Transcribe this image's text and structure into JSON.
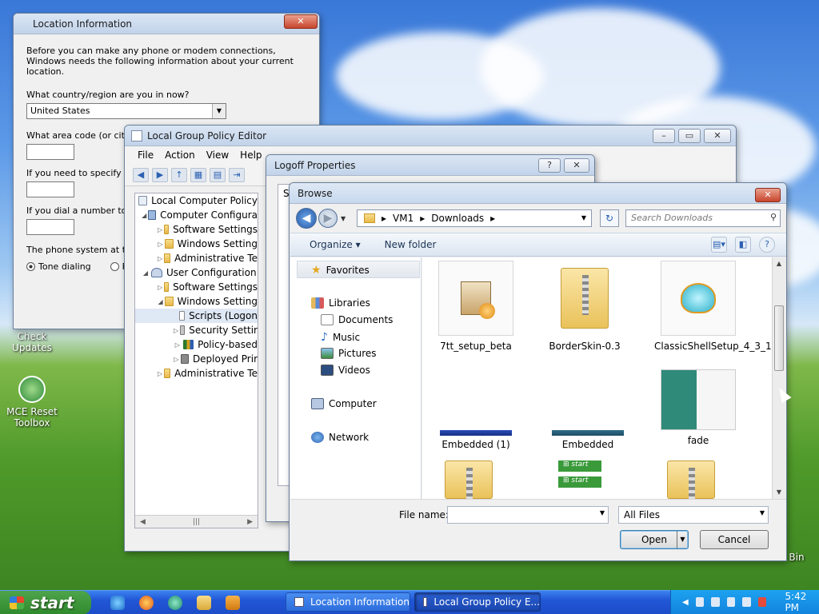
{
  "desktop": {
    "icons": [
      {
        "label": "Check Updates"
      },
      {
        "label": "MCE Reset Toolbox"
      },
      {
        "label": "Bin"
      }
    ]
  },
  "location_window": {
    "title": "Location Information",
    "intro": "Before you can make any phone or modem connections, Windows needs the following information about your current location.",
    "q_country": "What country/region are you in now?",
    "country_value": "United States",
    "q_area": "What area code (or city c",
    "q_carrier": "If you need to specify a c",
    "q_dial": "If you dial a number to ac",
    "q_phone_system": "The phone system at this",
    "tone_label": "Tone dialing",
    "pulse_label": "Pu"
  },
  "gpe": {
    "title": "Local Group Policy Editor",
    "menu": [
      "File",
      "Action",
      "View",
      "Help"
    ],
    "tree": [
      {
        "label": "Local Computer Policy"
      },
      {
        "label": "Computer Configura"
      },
      {
        "label": "Software Settings"
      },
      {
        "label": "Windows Setting"
      },
      {
        "label": "Administrative Te"
      },
      {
        "label": "User Configuration"
      },
      {
        "label": "Software Settings"
      },
      {
        "label": "Windows Setting"
      },
      {
        "label": "Scripts (Logon"
      },
      {
        "label": "Security Settir"
      },
      {
        "label": "Policy-based"
      },
      {
        "label": "Deployed Prir"
      },
      {
        "label": "Administrative Te"
      }
    ]
  },
  "logoff": {
    "title": "Logoff Properties",
    "help": "?",
    "body_char": "S"
  },
  "browse": {
    "title": "Browse",
    "breadcrumb": [
      "VM1",
      "Downloads"
    ],
    "search_placeholder": "Search Downloads",
    "organize": "Organize",
    "new_folder": "New folder",
    "nav": {
      "favorites": "Favorites",
      "libraries": "Libraries",
      "documents": "Documents",
      "music": "Music",
      "pictures": "Pictures",
      "videos": "Videos",
      "computer": "Computer",
      "network": "Network"
    },
    "files": [
      {
        "name": "7tt_setup_beta"
      },
      {
        "name": "BorderSkin-0.3"
      },
      {
        "name": "ClassicShellSetup_4_3_1"
      },
      {
        "name": "Embedded (1)"
      },
      {
        "name": "Embedded"
      },
      {
        "name": "fade"
      }
    ],
    "file_name_label": "File name:",
    "file_type": "All Files",
    "open_btn": "Open",
    "cancel_btn": "Cancel"
  },
  "taskbar": {
    "start": "start",
    "items": [
      {
        "label": "Location Information"
      },
      {
        "label": "Local Group Policy E..."
      }
    ],
    "clock": "5:42 PM"
  }
}
